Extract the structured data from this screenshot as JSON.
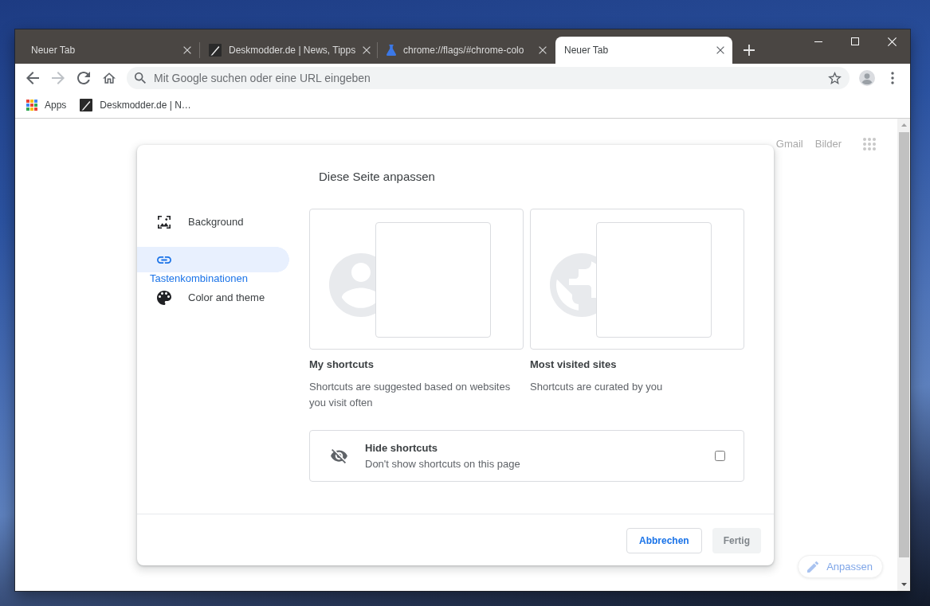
{
  "tabs": [
    {
      "title": "Neuer Tab",
      "kind": "newtab",
      "selected": false
    },
    {
      "title": "Deskmodder.de | News, Tipps",
      "kind": "site",
      "selected": false
    },
    {
      "title": "chrome://flags/#chrome-colo",
      "kind": "flags",
      "selected": false
    },
    {
      "title": "Neuer Tab",
      "kind": "newtab",
      "selected": true
    }
  ],
  "toolbar": {
    "nav": [
      {
        "kind": "back",
        "disabled": false
      },
      {
        "kind": "forward",
        "disabled": true
      },
      {
        "kind": "reload",
        "disabled": false
      },
      {
        "kind": "home",
        "disabled": false
      }
    ],
    "omnibox": {
      "placeholder": "Mit Google suchen oder eine URL eingeben"
    }
  },
  "bookmarks": [
    {
      "title": "Apps",
      "kind": "apps"
    },
    {
      "title": "Deskmodder.de | N…",
      "kind": "site"
    }
  ],
  "page": {
    "header_links": [
      "Gmail",
      "Bilder"
    ],
    "customize_button": "Anpassen"
  },
  "dialog": {
    "title": "Diese Seite anpassen",
    "sidebar": [
      {
        "label": "Background",
        "kind": "background",
        "selected": false
      },
      {
        "label": "Tastenkombinationen",
        "kind": "shortcuts",
        "selected": true
      },
      {
        "label": "Color and theme",
        "kind": "theme",
        "selected": false
      }
    ],
    "options": [
      {
        "title": "My shortcuts",
        "description": "Shortcuts are suggested based on websites you visit often",
        "kind": "custom",
        "selected": false
      },
      {
        "title": "Most visited sites",
        "description": "Shortcuts are curated by you",
        "kind": "most_visited",
        "selected": false
      }
    ],
    "hide_shortcuts": {
      "title": "Hide shortcuts",
      "description": "Don't show shortcuts on this page",
      "checked": false
    },
    "buttons": [
      {
        "label": "Abbrechen",
        "kind": "cancel",
        "disabled": false
      },
      {
        "label": "Fertig",
        "kind": "action",
        "disabled": true
      }
    ]
  }
}
